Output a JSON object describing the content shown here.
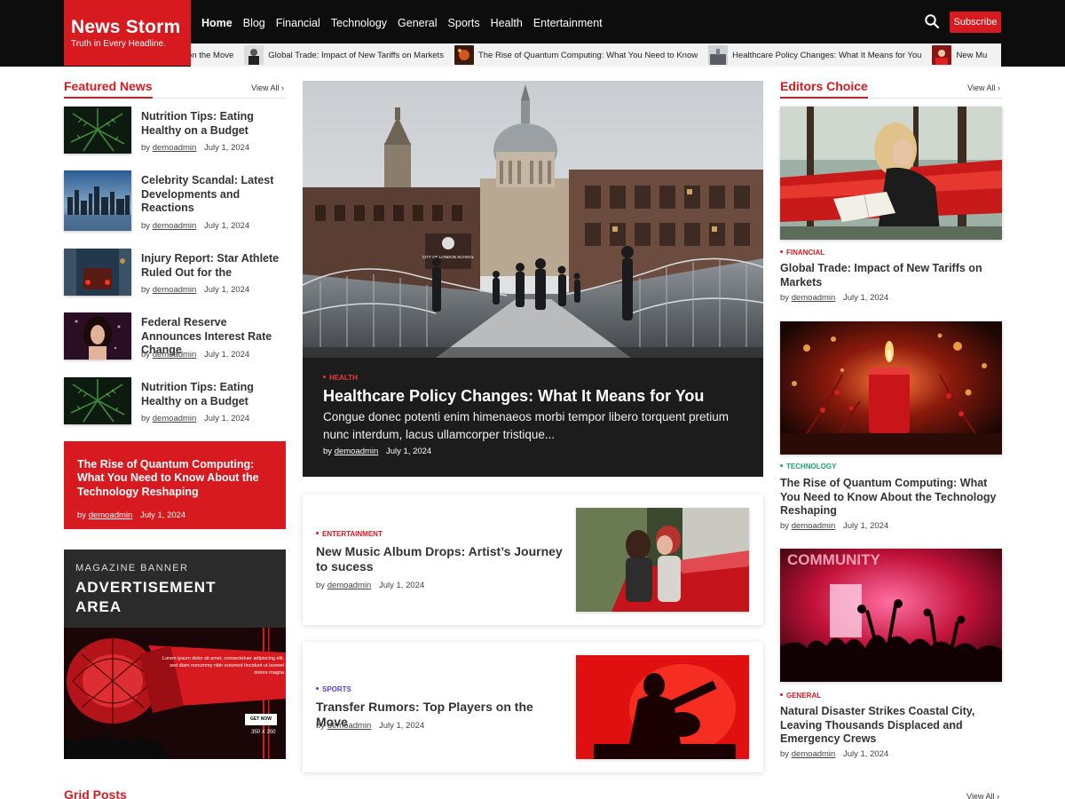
{
  "brand": {
    "name": "News Storm",
    "tagline": "Truth in Every Headline.",
    "accent": "#d71920"
  },
  "nav": {
    "items": [
      "Home",
      "Blog",
      "Financial",
      "Technology",
      "General",
      "Sports",
      "Health",
      "Entertainment"
    ],
    "active": "Home",
    "search_icon": "search-icon",
    "subscribe_label": "Subscribe"
  },
  "ticker": [
    "on the Move",
    "Global Trade: Impact of New Tariffs on Markets",
    "The Rise of Quantum Computing: What You Need to Know",
    "Healthcare Policy Changes: What It Means for You",
    "New Mu"
  ],
  "featured": {
    "heading": "Featured News",
    "view_all": "View All",
    "items": [
      {
        "title": "Nutrition Tips: Eating Healthy on a Budget",
        "author": "demoadmin",
        "date": "July 1, 2024"
      },
      {
        "title": "Celebrity Scandal: Latest Developments and Reactions",
        "author": "demoadmin",
        "date": "July 1, 2024"
      },
      {
        "title": "Injury Report: Star Athlete Ruled Out for the",
        "author": "demoadmin",
        "date": "July 1, 2024"
      },
      {
        "title": "Federal Reserve Announces Interest Rate Change",
        "author": "demoadmin",
        "date": "July 1, 2024"
      },
      {
        "title": "Nutrition Tips: Eating Healthy on a Budget",
        "author": "demoadmin",
        "date": "July 1, 2024"
      }
    ],
    "promo": {
      "title": "The Rise of Quantum Computing: What You Need to Know About the Technology Reshaping",
      "by": "by",
      "author": "demoadmin",
      "date": "July 1, 2024"
    }
  },
  "ad": {
    "small": "MAGAZINE BANNER",
    "big_line1": "ADVERTISEMENT",
    "big_line2": "AREA",
    "lorem": "Lorem ipsum dolor sit amet, consectetuer adipiscing elit, sed diam nonummy nibh euismod tincidunt ut laoreet dolore magna",
    "button": "GET NOW",
    "size": "350 X 350"
  },
  "hero": {
    "category": "HEALTH",
    "title": "Healthcare Policy Changes: What It Means for You",
    "excerpt": "Congue donec potenti enim himenaeos morbi tempor libero torquent pretium nunc interdum, lacus ullamcorper tristique...",
    "by": "by",
    "author": "demoadmin",
    "date": "July 1, 2024",
    "sign_text": "CITY OF LONDON SCHOOL"
  },
  "cards": [
    {
      "category": "ENTERTAINMENT",
      "cat_color": "#d71920",
      "title": "New Music Album Drops: Artist’s Journey to sucess",
      "by": "by",
      "author": "demoadmin",
      "date": "July 1, 2024"
    },
    {
      "category": "SPORTS",
      "cat_color": "#5a3fd6",
      "title": "Transfer Rumors: Top Players on the Move",
      "by": "by",
      "author": "demoadmin",
      "date": "July 1, 2024"
    }
  ],
  "editors": {
    "heading": "Editors Choice",
    "view_all": "View All",
    "items": [
      {
        "category": "FINANCIAL",
        "cat_color": "#d71920",
        "title": "Global Trade: Impact of New Tariffs on Markets",
        "by": "by",
        "author": "demoadmin",
        "date": "July 1, 2024"
      },
      {
        "category": "TECHNOLOGY",
        "cat_color": "#1fa36a",
        "title": "The Rise of Quantum Computing: What You Need to Know About the Technology Reshaping",
        "by": "by",
        "author": "demoadmin",
        "date": "July 1, 2024"
      },
      {
        "category": "GENERAL",
        "cat_color": "#d71920",
        "title": "Natural Disaster Strikes Coastal City, Leaving Thousands Displaced and Emergency Crews",
        "by": "by",
        "author": "demoadmin",
        "date": "July 1, 2024",
        "img_text": "COMMUNITY"
      }
    ]
  },
  "grid": {
    "heading": "Grid Posts",
    "view_all": "View All"
  }
}
